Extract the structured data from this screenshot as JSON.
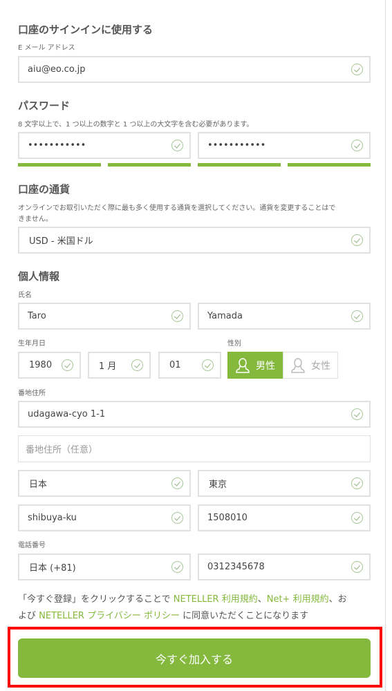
{
  "signin": {
    "heading": "口座のサインインに使用する",
    "email_label": "E メール アドレス",
    "email": "aiu@eo.co.jp"
  },
  "password": {
    "heading": "パスワード",
    "hint": "8 文字以上で、1 つ以上の数字と 1 つ以上の大文字を含む必要があります。",
    "value": "•••••••••••",
    "confirm": "•••••••••••",
    "strength": 1.0
  },
  "currency": {
    "heading": "口座の通貨",
    "desc_line1": "オンラインでお取引いただく際に最も多く使用する通貨を選択してください。通貨を変更することはで",
    "desc_line2": "きません。",
    "value": "USD - 米国ドル"
  },
  "personal": {
    "heading": "個人情報",
    "name_label": "氏名",
    "first": "Taro",
    "last": "Yamada",
    "dob_label": "生年月日",
    "year": "1980",
    "month": "1 月",
    "day": "01",
    "gender_label": "性別",
    "male": "男性",
    "female": "女性",
    "gender_selected": "male",
    "address_label": "番地住所",
    "address1": "udagawa-cyo 1-1",
    "address2_placeholder": "番地住所（任意）",
    "country": "日本",
    "prefecture": "東京",
    "city": "shibuya-ku",
    "zip": "1508010",
    "phone_label": "電話番号",
    "phone_code": "日本 (+81)",
    "phone": "0312345678"
  },
  "terms": {
    "t1": "「今すぐ登録」をクリックすることで ",
    "l1": "NETELLER 利用規約",
    "t2": "、",
    "l2": "Net+ 利用規約",
    "t3": "、お",
    "t4": "よび ",
    "l3": "NETELLER プライバシー ポリシー",
    "t5": " に同意いただくことになります"
  },
  "submit": {
    "label": "今すぐ加入する"
  },
  "colors": {
    "accent": "#84b93e",
    "highlight": "#ff0000"
  }
}
